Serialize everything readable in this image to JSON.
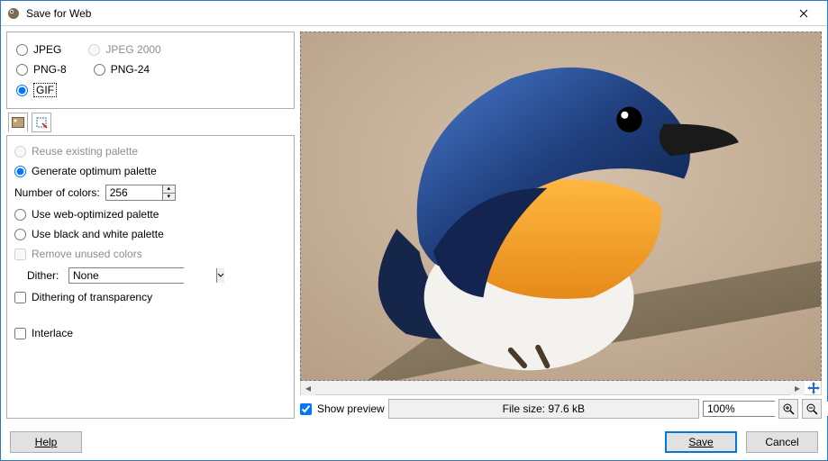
{
  "window": {
    "title": "Save for Web"
  },
  "formats": {
    "jpeg": "JPEG",
    "jpeg2000": "JPEG 2000",
    "png8": "PNG-8",
    "png24": "PNG-24",
    "gif": "GIF"
  },
  "palette": {
    "reuse": "Reuse existing palette",
    "generate": "Generate optimum palette",
    "num_colors_label": "Number of colors:",
    "num_colors_value": "256",
    "web": "Use web-optimized palette",
    "bw": "Use black and white palette",
    "remove_unused": "Remove unused colors",
    "dither_label": "Dither:",
    "dither_value": "None",
    "dither_trans": "Dithering of transparency",
    "interlace": "Interlace"
  },
  "preview": {
    "show_label": "Show preview",
    "filesize_label": "File size: 97.6 kB",
    "zoom_value": "100%"
  },
  "buttons": {
    "help": "Help",
    "save": "Save",
    "cancel": "Cancel"
  }
}
